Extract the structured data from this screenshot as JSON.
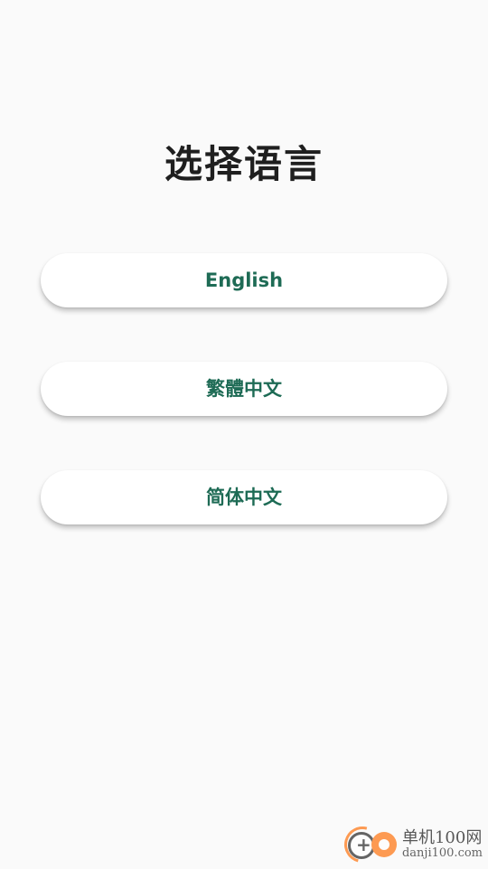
{
  "title": "选择语言",
  "languages": [
    {
      "label": "English"
    },
    {
      "label": "繁體中文"
    },
    {
      "label": "简体中文"
    }
  ],
  "watermark": {
    "name": "单机100网",
    "url": "danji100.com"
  },
  "colors": {
    "background": "#fafafa",
    "button_bg": "#ffffff",
    "button_text": "#1e6b55",
    "title_text": "#1f1f1f",
    "watermark_accent": "#ff7a1a"
  }
}
